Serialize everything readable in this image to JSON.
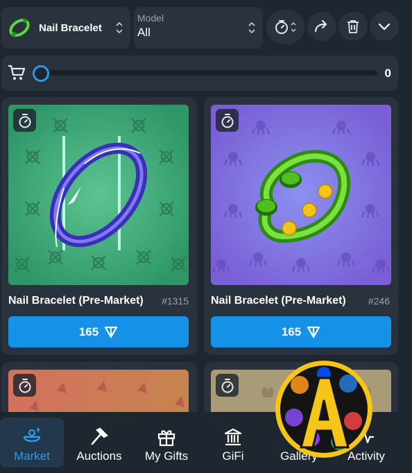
{
  "filters": {
    "gift_label": "Nail Bracelet",
    "model_caption": "Model",
    "model_value": "All"
  },
  "cart": {
    "count": "0",
    "slider_value": 0
  },
  "cards": [
    {
      "title": "Nail Bracelet (Pre-Market)",
      "number": "#1315",
      "price": "165",
      "background": "#3fa876"
    },
    {
      "title": "Nail Bracelet (Pre-Market)",
      "number": "#246",
      "price": "165",
      "background": "#7d6bd9"
    },
    {
      "title": "",
      "number": "",
      "price": "",
      "background": "#c86a5f"
    },
    {
      "title": "",
      "number": "",
      "price": "",
      "background": "#a99a78"
    }
  ],
  "nav": {
    "market": "Market",
    "auctions": "Auctions",
    "my_gifts": "My Gifts",
    "gifi": "GiFi",
    "gallery": "Gallery",
    "activity": "Activity"
  },
  "watermark": {
    "letter": "A"
  },
  "colors": {
    "accent": "#1591e8",
    "active_nav": "#2a9bea",
    "panel": "#2a323d",
    "page": "#1e2630"
  },
  "icons": [
    "bracelet-icon",
    "timer-icon",
    "share-icon",
    "trash-icon",
    "chevron-down-icon",
    "cart-icon",
    "clock-icon",
    "ton-icon",
    "market-icon",
    "gavel-icon",
    "gift-icon",
    "bank-icon",
    "gallery-icon",
    "activity-icon"
  ]
}
